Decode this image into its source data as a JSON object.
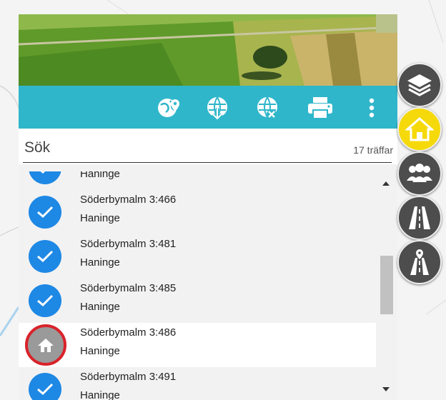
{
  "toolbar": {
    "icons": [
      "map-pin-icon",
      "globe-download-icon",
      "globe-remove-icon",
      "print-icon",
      "more-vertical-icon"
    ]
  },
  "search": {
    "placeholder": "Sök",
    "hit_count": "17 träffar"
  },
  "results": [
    {
      "name": "",
      "municipality": "Haninge",
      "icon": "check-icon",
      "active": false
    },
    {
      "name": "Söderbymalm 3:466",
      "municipality": "Haninge",
      "icon": "check-icon",
      "active": false
    },
    {
      "name": "Söderbymalm 3:481",
      "municipality": "Haninge",
      "icon": "check-icon",
      "active": false
    },
    {
      "name": "Söderbymalm 3:485",
      "municipality": "Haninge",
      "icon": "check-icon",
      "active": false
    },
    {
      "name": "Söderbymalm 3:486",
      "municipality": "Haninge",
      "icon": "home-icon",
      "active": true
    },
    {
      "name": "Söderbymalm 3:491",
      "municipality": "Haninge",
      "icon": "check-icon",
      "active": false
    }
  ],
  "side_buttons": [
    {
      "icon": "layers-icon",
      "active": false
    },
    {
      "icon": "home-icon",
      "active": true
    },
    {
      "icon": "people-icon",
      "active": false
    },
    {
      "icon": "road-icon",
      "active": false
    },
    {
      "icon": "road-marker-icon",
      "active": false
    }
  ],
  "colors": {
    "toolbar": "#2fb6cb",
    "check_badge": "#1e88e5",
    "active_side_button": "#f5d90a",
    "highlight_ring": "#d9232a"
  }
}
